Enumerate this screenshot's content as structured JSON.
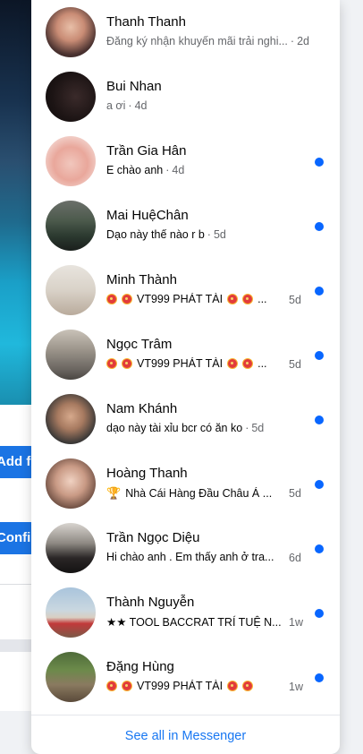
{
  "background": {
    "button_1_label": "Add friend",
    "button_2_label": "Confirm request"
  },
  "messenger": {
    "see_all_label": "See all in Messenger",
    "unread_color": "#0866ff",
    "conversations": [
      {
        "name": "Thanh Thanh",
        "preview": "Đăng ký nhận khuyến mãi trải nghi...",
        "time": "2d",
        "unread": false
      },
      {
        "name": "Bui Nhan",
        "preview": "a ơi",
        "time": "4d",
        "unread": false
      },
      {
        "name": "Trần Gia Hân",
        "preview": "E chào anh",
        "time": "4d",
        "unread": true
      },
      {
        "name": "Mai HuệChân",
        "preview": "Dạo này thế nào r b",
        "time": "5d",
        "unread": true
      },
      {
        "name": "Minh Thành",
        "preview": "VT999 PHÁT TÀI",
        "time": "5d",
        "unread": true
      },
      {
        "name": "Ngọc Trâm",
        "preview": "VT999 PHÁT TÀI",
        "time": "5d",
        "unread": true
      },
      {
        "name": "Nam Khánh",
        "preview": "dạo này tài xỉu bcr có ăn ko",
        "time": "5d",
        "unread": true
      },
      {
        "name": "Hoàng Thanh",
        "preview": "Nhà Cái Hàng Đầu Châu Á ...",
        "time": "5d",
        "unread": true
      },
      {
        "name": "Trần Ngọc Diệu",
        "preview": "Hi chào anh . Em thấy anh ở tra...",
        "time": "6d",
        "unread": true
      },
      {
        "name": "Thành Nguyễn",
        "preview": "★★ TOOL BACCRAT TRÍ TUỆ N...",
        "time": "1w",
        "unread": true
      },
      {
        "name": "Đặng Hùng",
        "preview": "VT999 PHÁT TÀI",
        "time": "1w",
        "unread": true
      }
    ]
  }
}
